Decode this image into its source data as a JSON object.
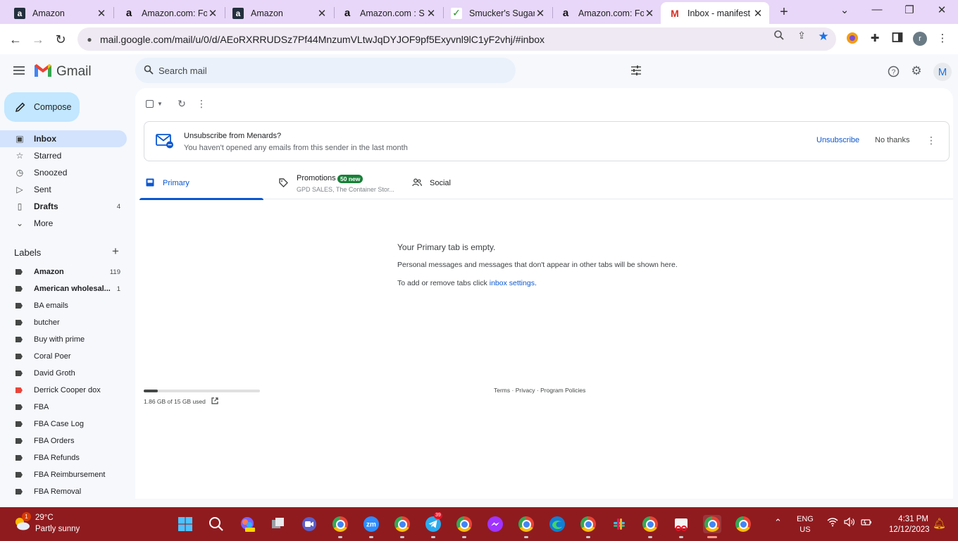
{
  "browser": {
    "tabs": [
      {
        "title": "Amazon",
        "favicon": "amazon-dark"
      },
      {
        "title": "Amazon.com: Fo",
        "favicon": "amazon-light"
      },
      {
        "title": "Amazon",
        "favicon": "amazon-dark"
      },
      {
        "title": "Amazon.com : S",
        "favicon": "amazon-light"
      },
      {
        "title": "Smucker's Sugar",
        "favicon": "smuckers"
      },
      {
        "title": "Amazon.com: Fo",
        "favicon": "amazon-light"
      },
      {
        "title": "Inbox - manifest",
        "favicon": "gmail"
      }
    ],
    "active_tab_index": 6,
    "url": "mail.google.com/mail/u/0/d/AEoRXRRUDSz7Pf44MnzumVLtwJqDYJOF9pf5Exyvnl9lC1yF2vhj/#inbox",
    "profile_initial": "r",
    "accent_color": "#e8d7f8"
  },
  "gmail": {
    "app_name": "Gmail",
    "search_placeholder": "Search mail",
    "avatar_initial": "M",
    "compose_label": "Compose",
    "nav": [
      {
        "label": "Inbox",
        "icon": "inbox-icon",
        "count": "",
        "selected": true,
        "bold": true
      },
      {
        "label": "Starred",
        "icon": "star-icon",
        "count": "",
        "selected": false,
        "bold": false
      },
      {
        "label": "Snoozed",
        "icon": "clock-icon",
        "count": "",
        "selected": false,
        "bold": false
      },
      {
        "label": "Sent",
        "icon": "send-icon",
        "count": "",
        "selected": false,
        "bold": false
      },
      {
        "label": "Drafts",
        "icon": "draft-icon",
        "count": "4",
        "selected": false,
        "bold": true
      },
      {
        "label": "More",
        "icon": "chevron-down-icon",
        "count": "",
        "selected": false,
        "bold": false
      }
    ],
    "labels_heading": "Labels",
    "labels": [
      {
        "label": "Amazon",
        "count": "119",
        "bold": true,
        "color": "#444746"
      },
      {
        "label": "American wholesal...",
        "count": "1",
        "bold": true,
        "color": "#444746"
      },
      {
        "label": "BA emails",
        "count": "",
        "bold": false,
        "color": "#444746"
      },
      {
        "label": "butcher",
        "count": "",
        "bold": false,
        "color": "#444746"
      },
      {
        "label": "Buy with prime",
        "count": "",
        "bold": false,
        "color": "#444746"
      },
      {
        "label": "Coral Poer",
        "count": "",
        "bold": false,
        "color": "#444746"
      },
      {
        "label": "David Groth",
        "count": "",
        "bold": false,
        "color": "#444746"
      },
      {
        "label": "Derrick Cooper dox",
        "count": "",
        "bold": false,
        "color": "#e8453c"
      },
      {
        "label": "FBA",
        "count": "",
        "bold": false,
        "color": "#444746"
      },
      {
        "label": "FBA Case Log",
        "count": "",
        "bold": false,
        "color": "#444746"
      },
      {
        "label": "FBA Orders",
        "count": "",
        "bold": false,
        "color": "#444746"
      },
      {
        "label": "FBA Refunds",
        "count": "",
        "bold": false,
        "color": "#444746"
      },
      {
        "label": "FBA Reimbursement",
        "count": "",
        "bold": false,
        "color": "#444746"
      },
      {
        "label": "FBA Removal",
        "count": "",
        "bold": false,
        "color": "#444746"
      }
    ],
    "banner": {
      "title": "Unsubscribe from Menards?",
      "subtitle": "You haven't opened any emails from this sender in the last month",
      "unsubscribe_label": "Unsubscribe",
      "no_thanks_label": "No thanks"
    },
    "category_tabs": [
      {
        "label": "Primary",
        "icon": "inbox-icon",
        "badge": "",
        "sub": "",
        "active": true
      },
      {
        "label": "Promotions",
        "icon": "tag-icon",
        "badge": "50 new",
        "sub": "GPD SALES, The Container Stor...",
        "active": false
      },
      {
        "label": "Social",
        "icon": "people-icon",
        "badge": "",
        "sub": "",
        "active": false
      }
    ],
    "empty": {
      "title": "Your Primary tab is empty.",
      "line1": "Personal messages and messages that don't appear in other tabs will be shown here.",
      "line2_prefix": "To add or remove tabs click ",
      "line2_link": "inbox settings",
      "line2_suffix": "."
    },
    "storage": {
      "text": "1.86 GB of 15 GB used",
      "fraction_used": 0.124
    },
    "footer": "Terms · Privacy · Program Policies"
  },
  "taskbar": {
    "weather_temp": "29°C",
    "weather_desc": "Partly sunny",
    "weather_badge": "1",
    "telegram_badge": "39",
    "lang_line1": "ENG",
    "lang_line2": "US",
    "time": "4:31 PM",
    "date": "12/12/2023",
    "bar_color": "#8f1b1f"
  }
}
